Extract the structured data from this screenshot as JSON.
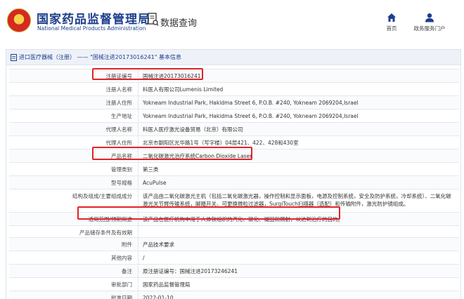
{
  "header": {
    "site_title_cn": "国家药品监督管理局",
    "site_title_en": "National Medical Products Administration",
    "query_label": "数据查询",
    "nav": [
      {
        "label": "首页",
        "icon": "home-icon"
      },
      {
        "label": "政务服务门户",
        "icon": "user-icon"
      }
    ]
  },
  "section": {
    "title": "进口医疗器械（注册） —— \"国械注进20173016241\" 基本信息"
  },
  "rows": [
    {
      "label": "注册证编号",
      "value": "国械注进20173016241"
    },
    {
      "label": "注册人名称",
      "value": "科医人有限公司Lumenis Limited"
    },
    {
      "label": "注册人住所",
      "value": "Yokneam Industrial Park, Hakidma Street 6, P.O.B. #240, Yokneam 2069204,Israel"
    },
    {
      "label": "生产地址",
      "value": "Yokneam Industrial Park, Hakidma Street 6, P.O.B. #240, Yokneam 2069204,Israel"
    },
    {
      "label": "代理人名称",
      "value": "科医人医疗激光设备贸易（北京）有限公司"
    },
    {
      "label": "代理人住所",
      "value": "北京市朝阳区光华路1号（写字楼）04层421、422、428和430室"
    },
    {
      "label": "产品名称",
      "value": "二氧化碳激光治疗系统Carbon Dioxide Laser"
    },
    {
      "label": "管理类别",
      "value": "第三类"
    },
    {
      "label": "型号规格",
      "value": "AcuPulse"
    },
    {
      "label": "结构及组成/主要组成成分",
      "value": "该产品由二氧化碳激光主机（包括二氧化碳激光器，操作控制和显示面板，电源及控制系统，安全及防护系统，冷却系统）、二氧化碳激光关节臂传输系统，脚踏开关、可更换微粒过滤器，SurgiTouch扫描器（选配）和传输附件，激光防护镜组成。"
    },
    {
      "label": "适用范围/预期用途",
      "value": "该产品在医疗机构中用于人体软组织的汽化、碳化、凝固和照射，以达到治疗的目的。"
    },
    {
      "label": "产品储存条件及有效期",
      "value": ""
    },
    {
      "label": "附件",
      "value": "产品技术要求"
    },
    {
      "label": "其他内容",
      "value": "/"
    },
    {
      "label": "备注",
      "value": "原注册证编号：国械注进20173246241"
    },
    {
      "label": "审批部门",
      "value": "国家药品监督管理局"
    },
    {
      "label": "批准日期",
      "value": "2022-01-10"
    }
  ],
  "colors": {
    "brand_blue": "#1d3f8c",
    "highlight_red": "#e0232a",
    "section_bar": "#eef2f8"
  }
}
